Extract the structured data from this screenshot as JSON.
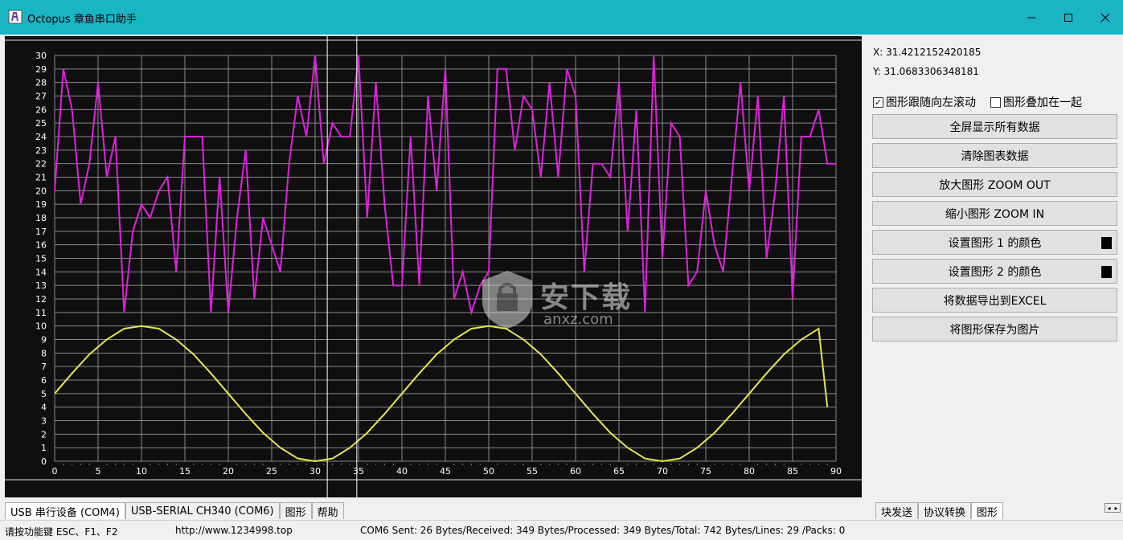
{
  "window": {
    "title": "Octopus 章鱼串口助手",
    "title_bar_color": "#1ab4c3"
  },
  "coords": {
    "x_label": "X: 31.4212152420185",
    "y_label": "Y: 31.0683306348181"
  },
  "options": {
    "scroll_label": "图形跟随向左滚动",
    "scroll_checked": true,
    "overlay_label": "图形叠加在一起",
    "overlay_checked": false
  },
  "buttons": [
    {
      "label": "全屏显示所有数据"
    },
    {
      "label": "清除图表数据"
    },
    {
      "label": "放大图形 ZOOM OUT"
    },
    {
      "label": "缩小图形 ZOOM IN"
    },
    {
      "label": "设置图形 1 的颜色"
    },
    {
      "label": "设置图形 2 的颜色"
    },
    {
      "label": "将数据导出到EXCEL"
    },
    {
      "label": "将图形保存为图片"
    }
  ],
  "tabs_left": [
    {
      "label": "USB 串行设备 (COM4)"
    },
    {
      "label": "USB-SERIAL CH340 (COM6)"
    },
    {
      "label": "图形"
    },
    {
      "label": "帮助"
    }
  ],
  "tabs_right": [
    {
      "label": "块发送"
    },
    {
      "label": "协议转换"
    },
    {
      "label": "图形"
    }
  ],
  "status": {
    "hint": "请按功能键 ESC、F1、F2",
    "url": "http://www.1234998.top",
    "stats": "COM6 Sent: 26 Bytes/Received: 349 Bytes/Processed: 349 Bytes/Total: 742 Bytes/Lines: 29 /Packs: 0"
  },
  "watermark": {
    "text_cn": "安下载",
    "text_en": "anxz.com"
  },
  "chart_data": {
    "type": "line",
    "xlim": [
      0,
      90
    ],
    "ylim": [
      0,
      30
    ],
    "x_ticks": [
      0,
      5,
      10,
      15,
      20,
      25,
      30,
      35,
      40,
      45,
      50,
      55,
      60,
      65,
      70,
      75,
      80,
      85,
      90
    ],
    "y_ticks": [
      0,
      1,
      2,
      3,
      4,
      5,
      6,
      7,
      8,
      9,
      10,
      11,
      12,
      13,
      14,
      15,
      16,
      17,
      18,
      19,
      20,
      21,
      22,
      23,
      24,
      25,
      26,
      27,
      28,
      29,
      30
    ],
    "grid": true,
    "cursor_x": [
      31.4,
      34.8
    ],
    "background": "#0f0f0f",
    "series": [
      {
        "color": "#e020e0",
        "x": [
          0,
          1,
          2,
          3,
          4,
          5,
          6,
          7,
          8,
          9,
          10,
          11,
          12,
          13,
          14,
          15,
          16,
          17,
          18,
          19,
          20,
          21,
          22,
          23,
          24,
          25,
          26,
          27,
          28,
          29,
          30,
          31,
          32,
          33,
          34,
          35,
          36,
          37,
          38,
          39,
          40,
          41,
          42,
          43,
          44,
          45,
          46,
          47,
          48,
          49,
          50,
          51,
          52,
          53,
          54,
          55,
          56,
          57,
          58,
          59,
          60,
          61,
          62,
          63,
          64,
          65,
          66,
          67,
          68,
          69,
          70,
          71,
          72,
          73,
          74,
          75,
          76,
          77,
          78,
          79,
          80,
          81,
          82,
          83,
          84,
          85,
          86,
          87,
          88,
          89,
          90
        ],
        "y": [
          20,
          29,
          26,
          19,
          22,
          28,
          21,
          24,
          11,
          17,
          19,
          18,
          20,
          21,
          14,
          24,
          24,
          24,
          11,
          21,
          11,
          18,
          23,
          12,
          18,
          16,
          14,
          22,
          27,
          24,
          30,
          22,
          25,
          24,
          24,
          30,
          18,
          28,
          19,
          13,
          13,
          24,
          13,
          27,
          20,
          29,
          12,
          14,
          11,
          13,
          14,
          29,
          29,
          23,
          27,
          26,
          21,
          28,
          21,
          29,
          27,
          14,
          22,
          22,
          21,
          28,
          17,
          26,
          11,
          30,
          15,
          25,
          24,
          13,
          14,
          20,
          16,
          14,
          21,
          28,
          20,
          27,
          15,
          20,
          27,
          12,
          24,
          24,
          26,
          22,
          22
        ]
      },
      {
        "color": "#e6e64a",
        "formula_note": "",
        "x": [
          0,
          2,
          4,
          6,
          8,
          10,
          12,
          14,
          16,
          18,
          20,
          22,
          24,
          26,
          28,
          30,
          32,
          34,
          36,
          38,
          40,
          42,
          44,
          46,
          48,
          50,
          52,
          54,
          56,
          58,
          60,
          62,
          64,
          66,
          68,
          70,
          72,
          74,
          76,
          78,
          80,
          82,
          84,
          86,
          88,
          89
        ],
        "y": [
          5,
          6.5,
          7.9,
          9.0,
          9.8,
          10,
          9.8,
          9.0,
          7.9,
          6.5,
          5,
          3.5,
          2.1,
          1.0,
          0.2,
          0,
          0.2,
          1.0,
          2.1,
          3.5,
          5,
          6.5,
          7.9,
          9.0,
          9.8,
          10,
          9.8,
          9.0,
          7.9,
          6.5,
          5,
          3.5,
          2.1,
          1.0,
          0.2,
          0,
          0.2,
          1.0,
          2.1,
          3.5,
          5,
          6.5,
          7.9,
          9.0,
          9.8,
          4
        ]
      }
    ]
  }
}
